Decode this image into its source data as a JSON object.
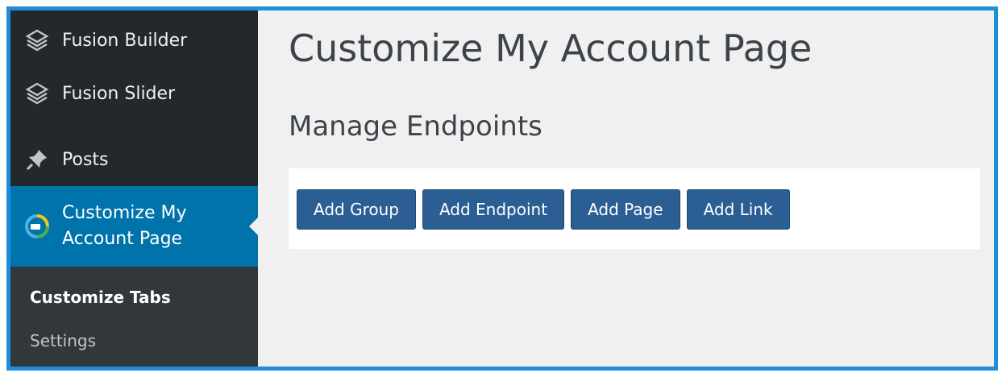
{
  "sidebar": {
    "items": [
      {
        "label": "Fusion Builder",
        "icon": "fusion-builder-icon"
      },
      {
        "label": "Fusion Slider",
        "icon": "fusion-slider-icon"
      },
      {
        "label": "Posts",
        "icon": "pin-icon"
      },
      {
        "label_line1": "Customize My",
        "label_line2": "Account Page",
        "icon": "customize-account-icon",
        "active": true
      }
    ],
    "submenu": [
      {
        "label": "Customize Tabs",
        "current": true
      },
      {
        "label": "Settings"
      }
    ]
  },
  "main": {
    "title": "Customize My Account Page",
    "section_title": "Manage Endpoints",
    "buttons": [
      "Add Group",
      "Add Endpoint",
      "Add Page",
      "Add Link"
    ]
  },
  "colors": {
    "frame_border": "#1e8fd6",
    "sidebar_bg": "#23282d",
    "submenu_bg": "#32373c",
    "active_bg": "#0073aa",
    "button_bg": "#2b5f93",
    "content_bg": "#f0f0f1"
  }
}
